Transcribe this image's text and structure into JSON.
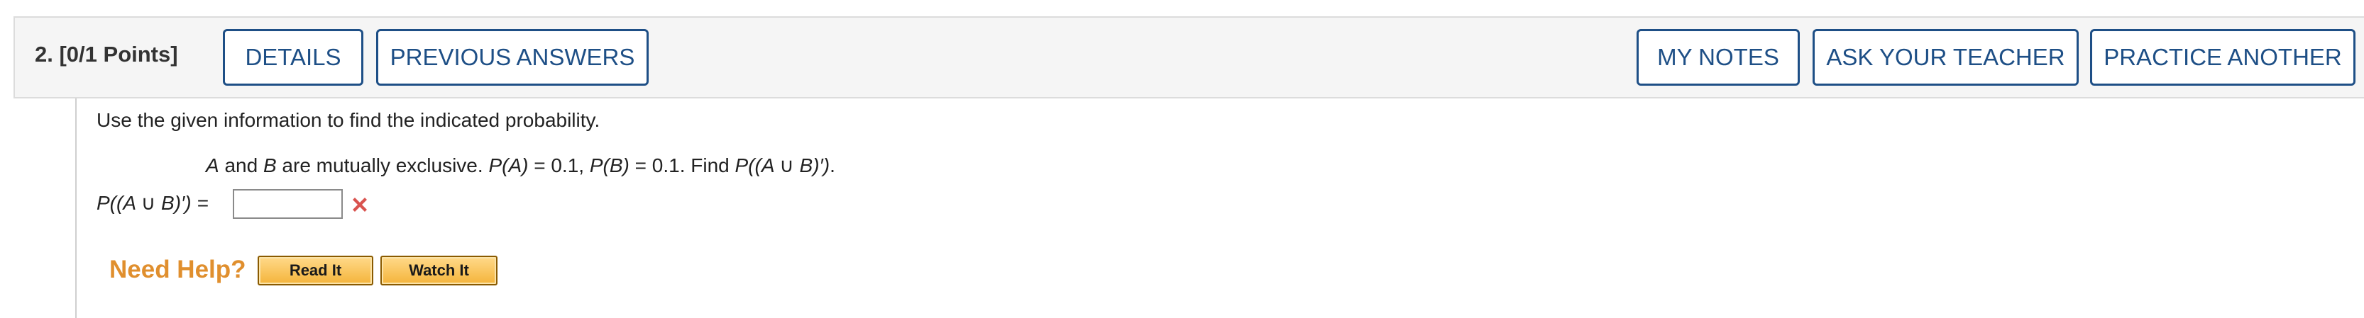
{
  "question": {
    "number_label": "2.",
    "points_label": "[0/1 Points]"
  },
  "header_buttons": {
    "details": "DETAILS",
    "previous_answers": "PREVIOUS ANSWERS",
    "my_notes": "MY NOTES",
    "ask_your_teacher": "ASK YOUR TEACHER",
    "practice_another": "PRACTICE ANOTHER"
  },
  "body": {
    "prompt": "Use the given information to find the indicated probability.",
    "statement": {
      "var_a": "A",
      "t1": " and ",
      "var_b": "B",
      "t2": " are mutually exclusive. ",
      "pa_label": "P(A)",
      "t3": " = 0.1, ",
      "pb_label": "P(B)",
      "t4": " = 0.1. Find ",
      "target": "P((A ∪ B)′)",
      "t5": "."
    },
    "answer": {
      "label": "P((A ∪ B)′) =",
      "value": "",
      "status_icon": "red-x-icon",
      "status": "incorrect"
    }
  },
  "help": {
    "label": "Need Help?",
    "read_it": "Read It",
    "watch_it": "Watch It"
  },
  "colors": {
    "button_blue": "#1e4f86",
    "need_help_orange": "#e08f2e",
    "wrong_red": "#d9534f",
    "header_bg": "#f5f5f5"
  }
}
